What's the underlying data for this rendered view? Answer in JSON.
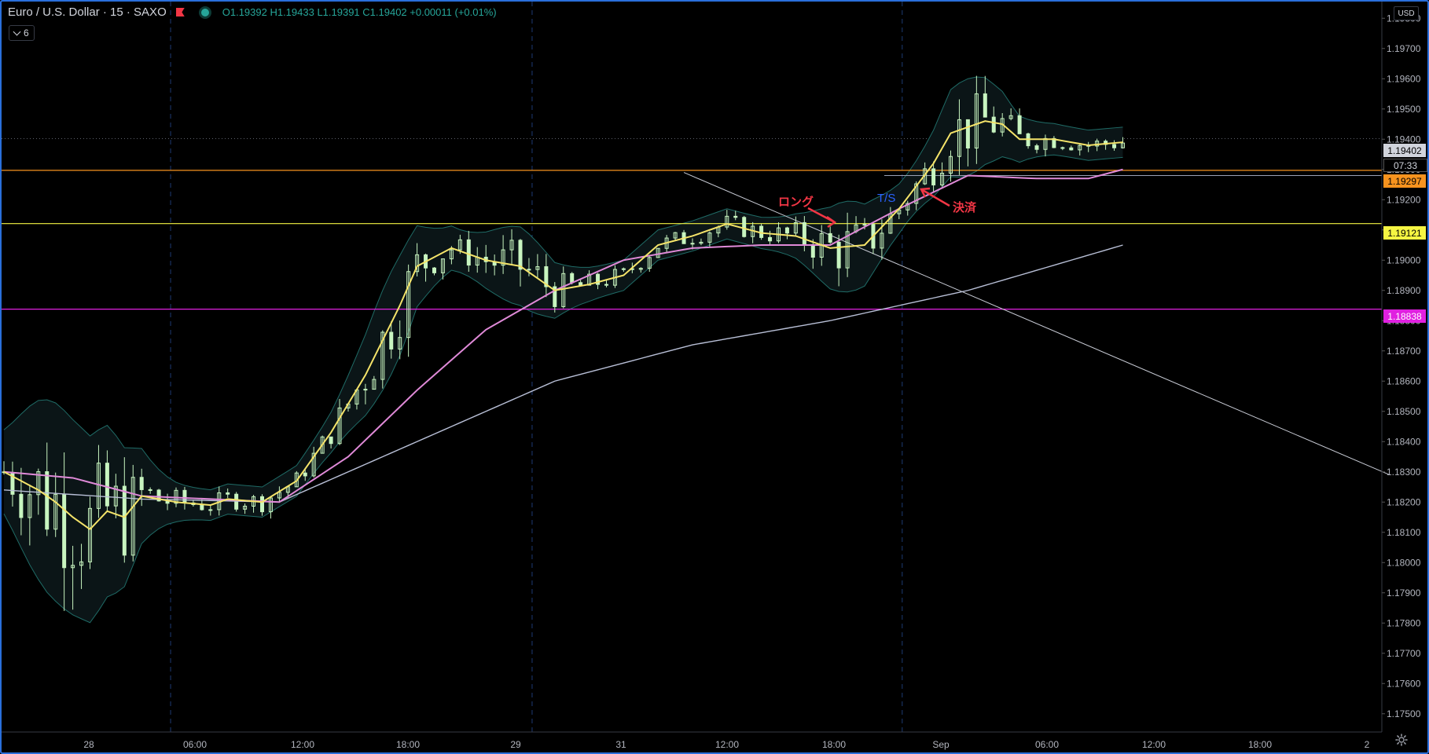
{
  "legend": {
    "symbol": "Euro / U.S. Dollar · 15 · SAXO",
    "ohlc": "O1.19392 H1.19433 L1.19391 C1.19402 +0.00011 (+0.01%)",
    "indicator_count": "6"
  },
  "price_axis": {
    "currency": "USD",
    "ticks": [
      "1.19800",
      "1.19700",
      "1.19600",
      "1.19500",
      "1.19400",
      "1.19300",
      "1.19200",
      "1.19100",
      "1.19000",
      "1.18900",
      "1.18800",
      "1.18700",
      "1.18600",
      "1.18500",
      "1.18400",
      "1.18300",
      "1.18200",
      "1.18100",
      "1.18000",
      "1.17900",
      "1.17800",
      "1.17700",
      "1.17600",
      "1.17500"
    ],
    "last_price": "1.19402",
    "countdown": "07:33",
    "level_orange": "1.19297",
    "level_yellow": "1.19121",
    "level_magenta": "1.18838"
  },
  "time_axis": {
    "ticks": [
      "28",
      "06:00",
      "12:00",
      "18:00",
      "29",
      "31",
      "12:00",
      "18:00",
      "Sep",
      "06:00",
      "12:00",
      "18:00",
      "2"
    ]
  },
  "annotations": {
    "long": "ロング",
    "ts": "T/S",
    "exit": "決済"
  },
  "colors": {
    "background": "#000000",
    "bull": "#c8f5c0",
    "ma_fast": "#f5e46a",
    "ma_mid": "#e08ad8",
    "ma_slow": "#b8bfd6",
    "band": "#1f6b66",
    "orange_level": "#f7931e",
    "yellow_level": "#f5f542",
    "magenta_level": "#e020e0",
    "annotation_red": "#f23645",
    "annotation_blue": "#2962ff"
  },
  "chart_data": {
    "type": "line",
    "symbol": "EURUSD",
    "interval": "15",
    "y_range": [
      1.1745,
      1.1985
    ],
    "horizontal_levels": [
      1.19297,
      1.19121,
      1.18838
    ],
    "series": [
      {
        "values": [
          [
            0,
            1.183
          ],
          [
            4,
            1.1824
          ],
          [
            6,
            1.182
          ],
          [
            8,
            1.1815
          ],
          [
            10,
            1.1811
          ],
          [
            12,
            1.1817
          ],
          [
            14,
            1.1815
          ],
          [
            16,
            1.1822
          ],
          [
            20,
            1.182
          ],
          [
            24,
            1.1819
          ],
          [
            26,
            1.1821
          ],
          [
            30,
            1.182
          ],
          [
            34,
            1.1827
          ],
          [
            38,
            1.1843
          ],
          [
            42,
            1.1862
          ],
          [
            46,
            1.1885
          ],
          [
            48,
            1.1898
          ],
          [
            52,
            1.1904
          ],
          [
            56,
            1.19
          ],
          [
            60,
            1.1898
          ],
          [
            64,
            1.189
          ],
          [
            68,
            1.1892
          ],
          [
            72,
            1.1895
          ],
          [
            76,
            1.1905
          ],
          [
            80,
            1.1908
          ],
          [
            84,
            1.1912
          ],
          [
            88,
            1.1909
          ],
          [
            92,
            1.1908
          ],
          [
            96,
            1.1904
          ],
          [
            100,
            1.1905
          ],
          [
            104,
            1.1917
          ],
          [
            108,
            1.1932
          ],
          [
            110,
            1.1942
          ],
          [
            114,
            1.1946
          ],
          [
            116,
            1.1945
          ],
          [
            118,
            1.194
          ],
          [
            122,
            1.194
          ],
          [
            126,
            1.1938
          ],
          [
            130,
            1.1939
          ]
        ]
      },
      {
        "values": [
          [
            0,
            1.183
          ],
          [
            8,
            1.1828
          ],
          [
            16,
            1.1822
          ],
          [
            24,
            1.1821
          ],
          [
            32,
            1.182
          ],
          [
            40,
            1.1835
          ],
          [
            48,
            1.1857
          ],
          [
            56,
            1.1877
          ],
          [
            64,
            1.189
          ],
          [
            72,
            1.19
          ],
          [
            80,
            1.1904
          ],
          [
            88,
            1.1905
          ],
          [
            96,
            1.1905
          ],
          [
            104,
            1.1917
          ],
          [
            112,
            1.1928
          ],
          [
            120,
            1.1927
          ],
          [
            126,
            1.1927
          ],
          [
            130,
            1.193
          ]
        ]
      },
      {
        "values": [
          [
            0,
            1.1824
          ],
          [
            16,
            1.1821
          ],
          [
            32,
            1.182
          ],
          [
            48,
            1.184
          ],
          [
            64,
            1.186
          ],
          [
            80,
            1.1872
          ],
          [
            96,
            1.188
          ],
          [
            112,
            1.189
          ],
          [
            130,
            1.1905
          ]
        ]
      }
    ],
    "trendline": [
      [
        79,
        1.1929
      ],
      [
        161,
        1.1829
      ]
    ]
  }
}
